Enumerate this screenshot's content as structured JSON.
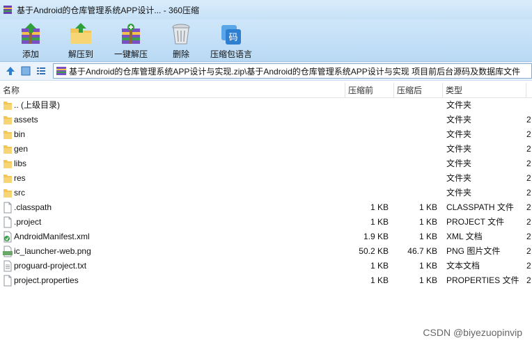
{
  "window": {
    "title": "基于Android的仓库管理系统APP设计... - 360压缩"
  },
  "toolbar": {
    "buttons": [
      {
        "label": "添加",
        "icon": "add-archive-icon"
      },
      {
        "label": "解压到",
        "icon": "extract-to-folder-icon"
      },
      {
        "label": "一键解压",
        "icon": "one-click-extract-icon"
      },
      {
        "label": "删除",
        "icon": "trash-bin-icon"
      },
      {
        "label": "压缩包语言",
        "icon": "archive-language-icon"
      }
    ],
    "lang_icon_glyph": "码"
  },
  "address": {
    "path": "基于Android的仓库管理系统APP设计与实现.zip\\基于Android的仓库管理系统APP设计与实现 项目前后台源码及数据库文件"
  },
  "table": {
    "columns": [
      "名称",
      "压缩前",
      "压缩后",
      "类型",
      ""
    ],
    "rows": [
      {
        "name": ".. (上级目录)",
        "size": "",
        "packed": "",
        "type": "文件夹",
        "extra": "",
        "icon": "folder-icon"
      },
      {
        "name": "assets",
        "size": "",
        "packed": "",
        "type": "文件夹",
        "extra": "2",
        "icon": "folder-icon"
      },
      {
        "name": "bin",
        "size": "",
        "packed": "",
        "type": "文件夹",
        "extra": "2",
        "icon": "folder-icon"
      },
      {
        "name": "gen",
        "size": "",
        "packed": "",
        "type": "文件夹",
        "extra": "2",
        "icon": "folder-icon"
      },
      {
        "name": "libs",
        "size": "",
        "packed": "",
        "type": "文件夹",
        "extra": "2",
        "icon": "folder-icon"
      },
      {
        "name": "res",
        "size": "",
        "packed": "",
        "type": "文件夹",
        "extra": "2",
        "icon": "folder-icon"
      },
      {
        "name": "src",
        "size": "",
        "packed": "",
        "type": "文件夹",
        "extra": "2",
        "icon": "folder-icon"
      },
      {
        "name": ".classpath",
        "size": "1 KB",
        "packed": "1 KB",
        "type": "CLASSPATH 文件",
        "extra": "2",
        "icon": "file-icon"
      },
      {
        "name": ".project",
        "size": "1 KB",
        "packed": "1 KB",
        "type": "PROJECT 文件",
        "extra": "2",
        "icon": "file-icon"
      },
      {
        "name": "AndroidManifest.xml",
        "size": "1.9 KB",
        "packed": "1 KB",
        "type": "XML 文档",
        "extra": "2",
        "icon": "xml-file-icon"
      },
      {
        "name": "ic_launcher-web.png",
        "size": "50.2 KB",
        "packed": "46.7 KB",
        "type": "PNG 图片文件",
        "extra": "2",
        "icon": "png-file-icon"
      },
      {
        "name": "proguard-project.txt",
        "size": "1 KB",
        "packed": "1 KB",
        "type": "文本文档",
        "extra": "2",
        "icon": "text-file-icon"
      },
      {
        "name": "project.properties",
        "size": "1 KB",
        "packed": "1 KB",
        "type": "PROPERTIES 文件",
        "extra": "2",
        "icon": "file-icon"
      }
    ]
  },
  "watermark": "CSDN @biyezuopinvip",
  "colors": {
    "toolbar_bg": "#c7e1f7",
    "folder": "#f3c552",
    "accent": "#2f7fd1"
  }
}
